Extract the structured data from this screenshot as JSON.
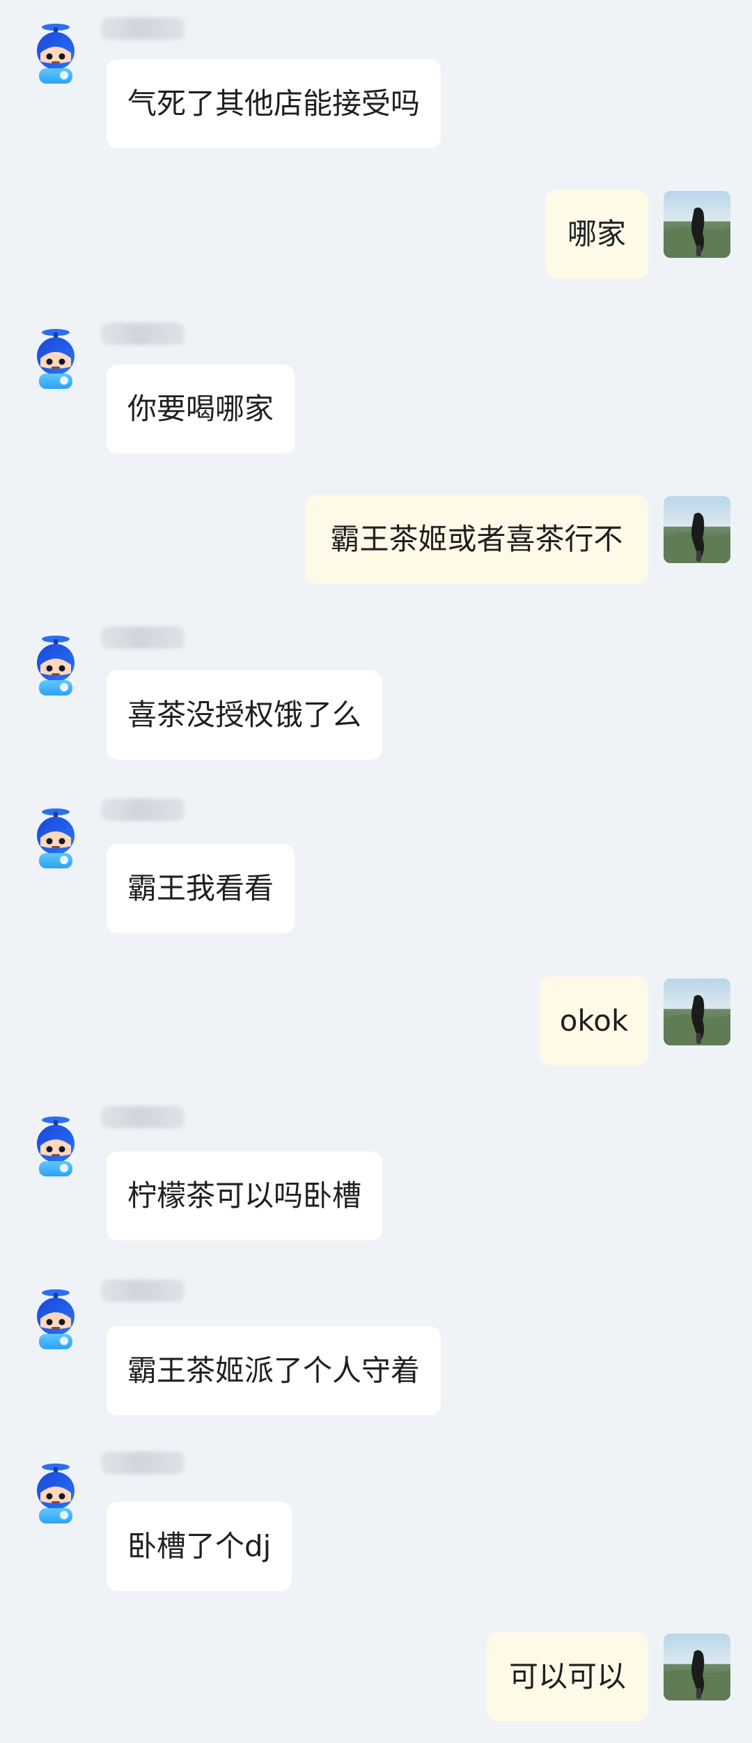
{
  "chat": {
    "messages": [
      {
        "side": "left",
        "text": "气死了其他店能接受吗"
      },
      {
        "side": "right",
        "text": "哪家"
      },
      {
        "side": "left",
        "text": "你要喝哪家"
      },
      {
        "side": "right",
        "text": "霸王茶姬或者喜茶行不"
      },
      {
        "side": "left",
        "text": "喜茶没授权饿了么"
      },
      {
        "side": "left",
        "text": "霸王我看看"
      },
      {
        "side": "right",
        "text": "okok"
      },
      {
        "side": "left",
        "text": "柠檬茶可以吗卧槽"
      },
      {
        "side": "left",
        "text": "霸王茶姬派了个人守着"
      },
      {
        "side": "left",
        "text": "卧槽了个dj"
      },
      {
        "side": "right",
        "text": "可以可以"
      }
    ]
  },
  "icons": {
    "bot_avatar": "robot-avatar-icon",
    "user_avatar": "user-photo-avatar"
  },
  "colors": {
    "background": "#eff3f7",
    "left_bubble": "#ffffff",
    "right_bubble": "#fff9e8",
    "text": "#1f1f1f"
  }
}
